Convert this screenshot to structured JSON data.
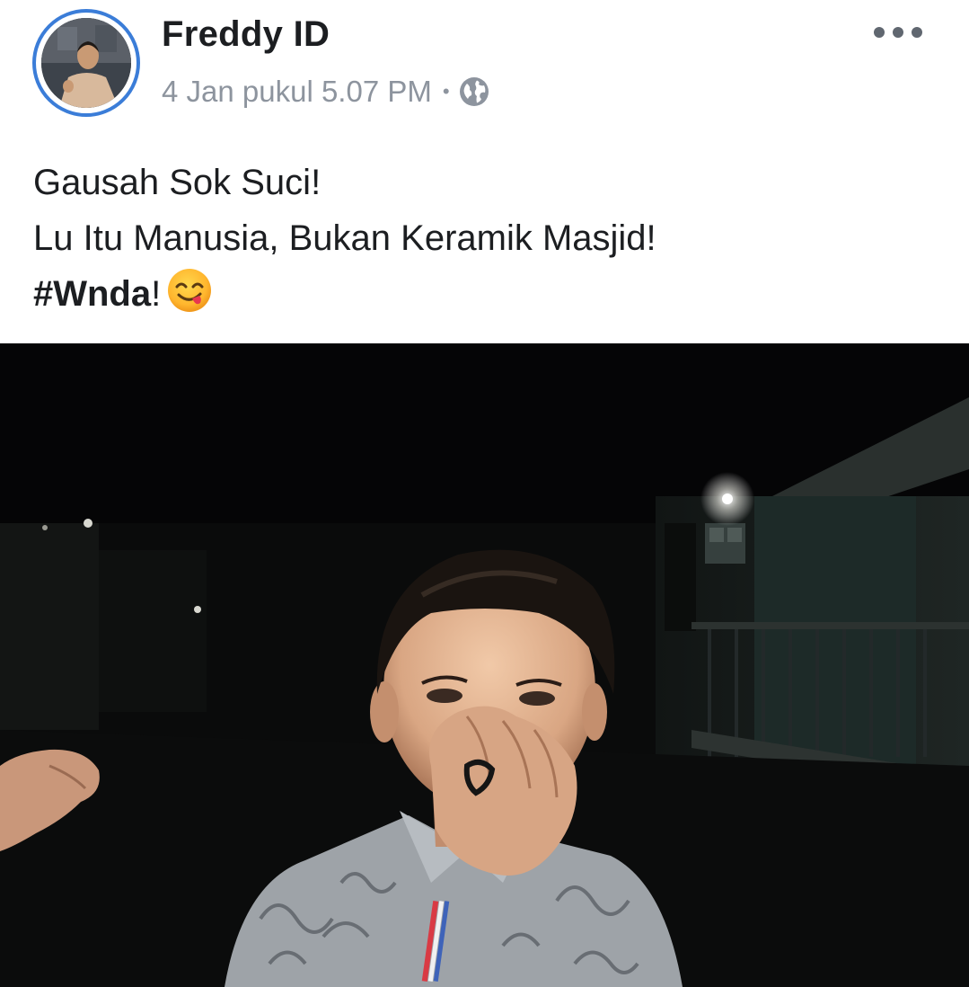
{
  "post": {
    "author": "Freddy ID",
    "timestamp": "4 Jan pukul 5.07 PM",
    "separator": "•",
    "privacy_icon": "globe-icon",
    "more_icon": "more-options-icon",
    "text": {
      "line1": "Gausah Sok Suci!",
      "line2": "Lu Itu Manusia, Bukan Keramik Masjid!",
      "hashtag": "#Wnda",
      "after_hashtag": "!",
      "emoji": "face-savoring-food-emoji"
    },
    "photo_icon": "post-photo"
  },
  "colors": {
    "avatar_ring": "#3b7dd8",
    "name_text": "#1c1e21",
    "meta_text": "#8d949e"
  }
}
